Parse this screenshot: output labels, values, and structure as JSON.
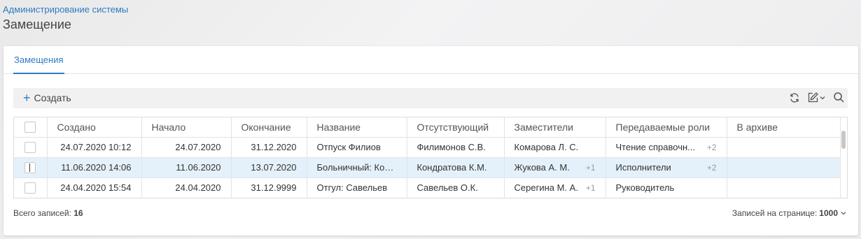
{
  "breadcrumb": "Администрирование системы",
  "page_title": "Замещение",
  "tabs": [
    {
      "label": "Замещения"
    }
  ],
  "toolbar": {
    "create_label": "Создать"
  },
  "table": {
    "columns": [
      "",
      "Создано",
      "Начало",
      "Окончание",
      "Название",
      "Отсутствующий",
      "Заместители",
      "Передаваемые роли",
      "В архиве"
    ],
    "rows": [
      {
        "created": "24.07.2020 10:12",
        "start": "24.07.2020",
        "end": "31.12.2020",
        "name": "Отпуск Филиов",
        "absent": "Филимонов С.В.",
        "deputies": "Комарова Л. С.",
        "deputies_more": "",
        "roles": "Чтение справочн...",
        "roles_more": "+2",
        "archive": ""
      },
      {
        "created": "11.06.2020 14:06",
        "start": "11.06.2020",
        "end": "13.07.2020",
        "name": "Больничный: Кон...",
        "absent": "Кондратова К.М.",
        "deputies": "Жукова А. М.",
        "deputies_more": "+1",
        "roles": "Исполнители",
        "roles_more": "+2",
        "archive": ""
      },
      {
        "created": "24.04.2020 15:54",
        "start": "24.04.2020",
        "end": "31.12.9999",
        "name": "Отгул: Савельев",
        "absent": "Савельев О.К.",
        "deputies": "Серегина М. А.",
        "deputies_more": "+1",
        "roles": "Руководитель",
        "roles_more": "",
        "archive": ""
      }
    ]
  },
  "footer": {
    "total_label": "Всего записей:",
    "total_value": "16",
    "per_page_label": "Записей на странице:",
    "per_page_value": "1000"
  },
  "colors": {
    "accent": "#2f7bbf",
    "selected_row": "#e5f1fa"
  },
  "icons": [
    "plus-icon",
    "refresh-icon",
    "edit-icon",
    "chevron-down-icon",
    "search-icon"
  ]
}
